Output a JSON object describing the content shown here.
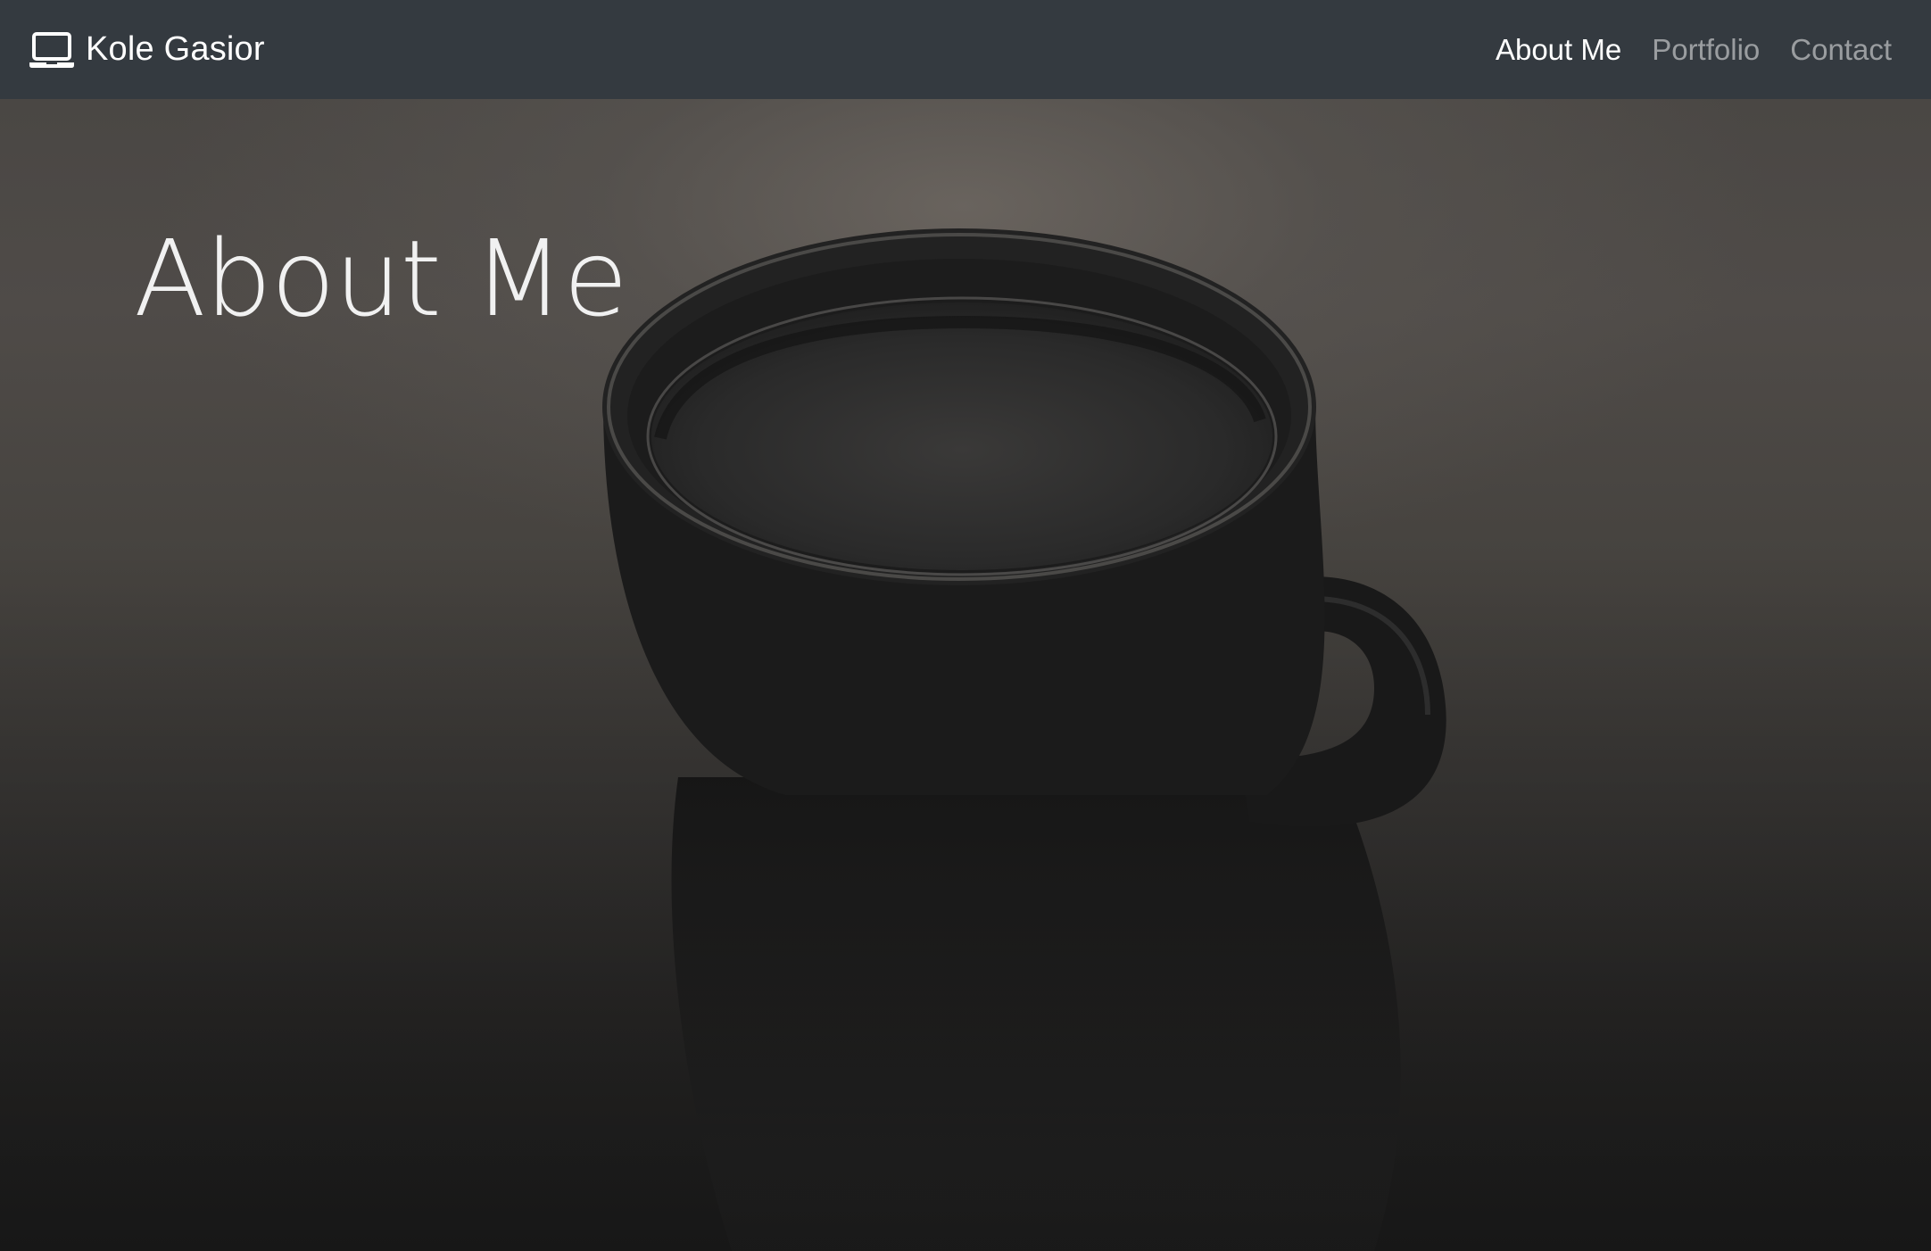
{
  "navbar": {
    "brand": {
      "icon": "laptop-icon",
      "label": "Kole Gasior"
    },
    "links": [
      {
        "label": "About Me",
        "active": true
      },
      {
        "label": "Portfolio",
        "active": false
      },
      {
        "label": "Contact",
        "active": false
      }
    ],
    "background_color": "#343a40"
  },
  "hero": {
    "title": "About Me",
    "background_image": "dark coffee cup on wooden table"
  }
}
